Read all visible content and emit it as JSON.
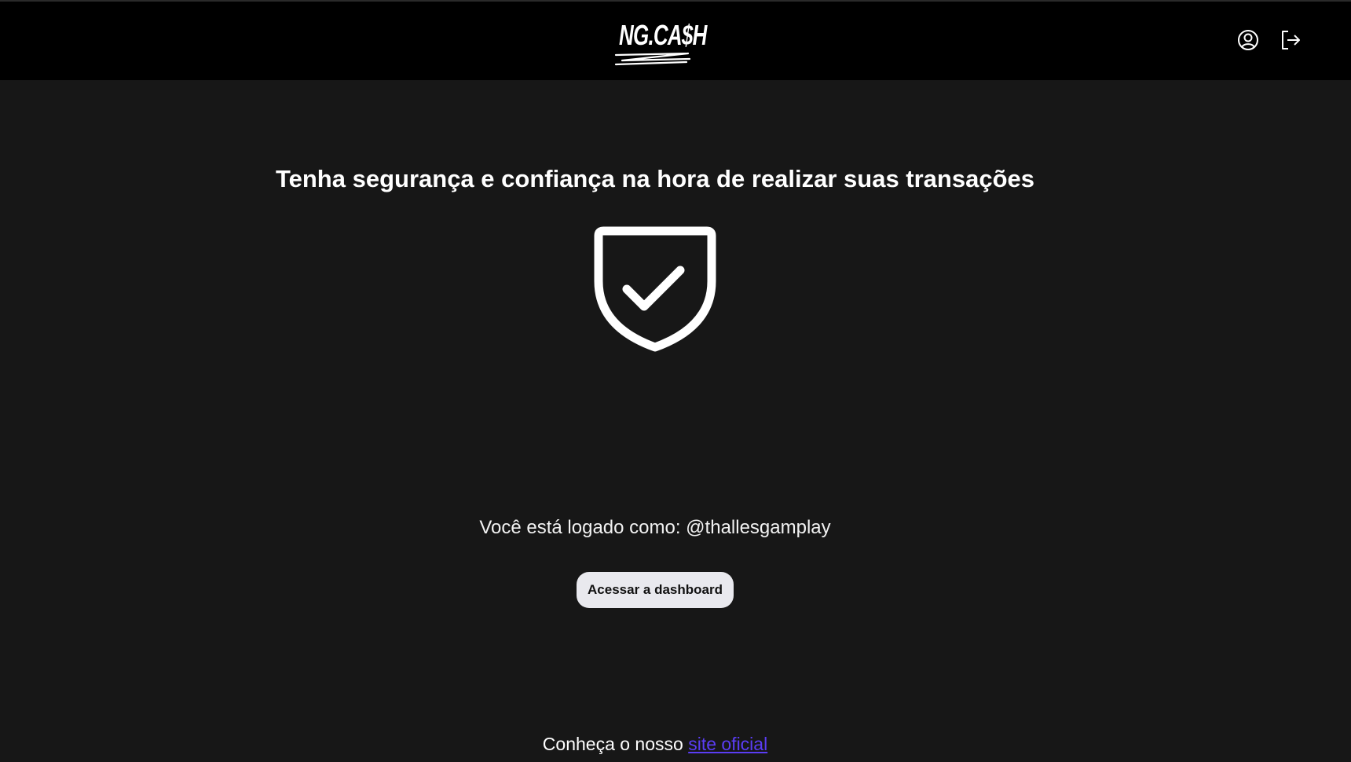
{
  "header": {
    "logo_text": "NG.CA$H",
    "icons": {
      "profile": "user-circle-icon",
      "logout": "logout-icon"
    }
  },
  "main": {
    "headline": "Tenha segurança e confiança na hora de realizar suas transações",
    "illustration": "shield-check-icon",
    "login_status": "Você está logado como: @thallesgamplay",
    "dashboard_button": "Acessar a dashboard"
  },
  "footer": {
    "text": "Conheça o nosso ",
    "link_label": "site oficial"
  },
  "colors": {
    "header_bg": "#000000",
    "page_bg": "#171717",
    "button_bg": "#e9e9ee",
    "link": "#5b3df5"
  }
}
